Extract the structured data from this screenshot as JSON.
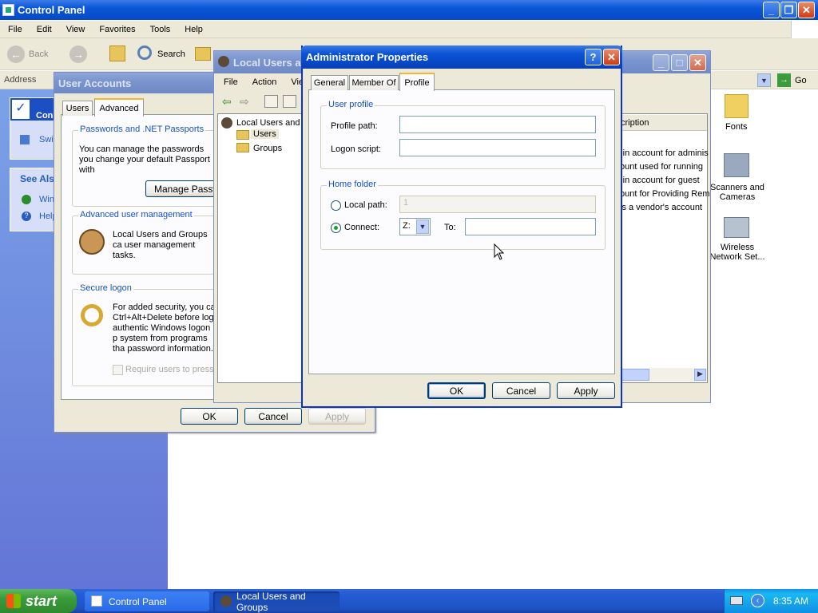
{
  "control_panel": {
    "title": "Control Panel",
    "menu": [
      "File",
      "Edit",
      "View",
      "Favorites",
      "Tools",
      "Help"
    ],
    "toolbar": {
      "back": "Back",
      "search": "Search"
    },
    "address_label": "Address",
    "go": "Go",
    "sidebar": {
      "see_also": "See Als",
      "item_con": "Con",
      "item_swi": "Swi",
      "item_win": "Win",
      "item_help": "Help"
    },
    "icons": [
      {
        "name": "fonts-icon",
        "label": "Fonts"
      },
      {
        "name": "scanners-icon",
        "label": "Scanners and Cameras"
      },
      {
        "name": "wireless-icon",
        "label": "Wireless Network Set..."
      }
    ]
  },
  "user_accounts": {
    "title": "User Accounts",
    "tabs": [
      "Users",
      "Advanced"
    ],
    "passwords_group": "Passwords and .NET Passports",
    "passwords_text": "You can manage the passwords you change your default Passport with",
    "manage_btn": "Manage Passwo",
    "advanced_group": "Advanced user management",
    "advanced_text": "Local Users and Groups ca user management tasks.",
    "secure_group": "Secure logon",
    "secure_text": "For added security, you ca Ctrl+Alt+Delete before log authentic Windows logon p system from programs tha password information.",
    "require_check": "Require users to press",
    "ok": "OK",
    "cancel": "Cancel",
    "apply": "Apply"
  },
  "lusrmgr": {
    "title": "Local Users a",
    "menu": [
      "File",
      "Action",
      "View"
    ],
    "tree_root": "Local Users and",
    "tree_users": "Users",
    "tree_groups": "Groups",
    "col_desc": "cription",
    "rows": [
      "-in account for adminis",
      "ount used for running",
      "-in account for guest",
      "ount for Providing Rem",
      "is a vendor's account"
    ]
  },
  "dialog": {
    "title": "Administrator Properties",
    "tabs": [
      "General",
      "Member Of",
      "Profile"
    ],
    "user_profile_group": "User profile",
    "profile_path_label": "Profile path:",
    "logon_script_label": "Logon script:",
    "home_folder_group": "Home folder",
    "local_path_label": "Local path:",
    "local_path_value": "1",
    "connect_label": "Connect:",
    "drive_value": "Z:",
    "to_label": "To:",
    "ok": "OK",
    "cancel": "Cancel",
    "apply": "Apply"
  },
  "taskbar": {
    "start": "start",
    "items": [
      "Control Panel",
      "Local Users and Groups"
    ],
    "clock": "8:35 AM"
  }
}
